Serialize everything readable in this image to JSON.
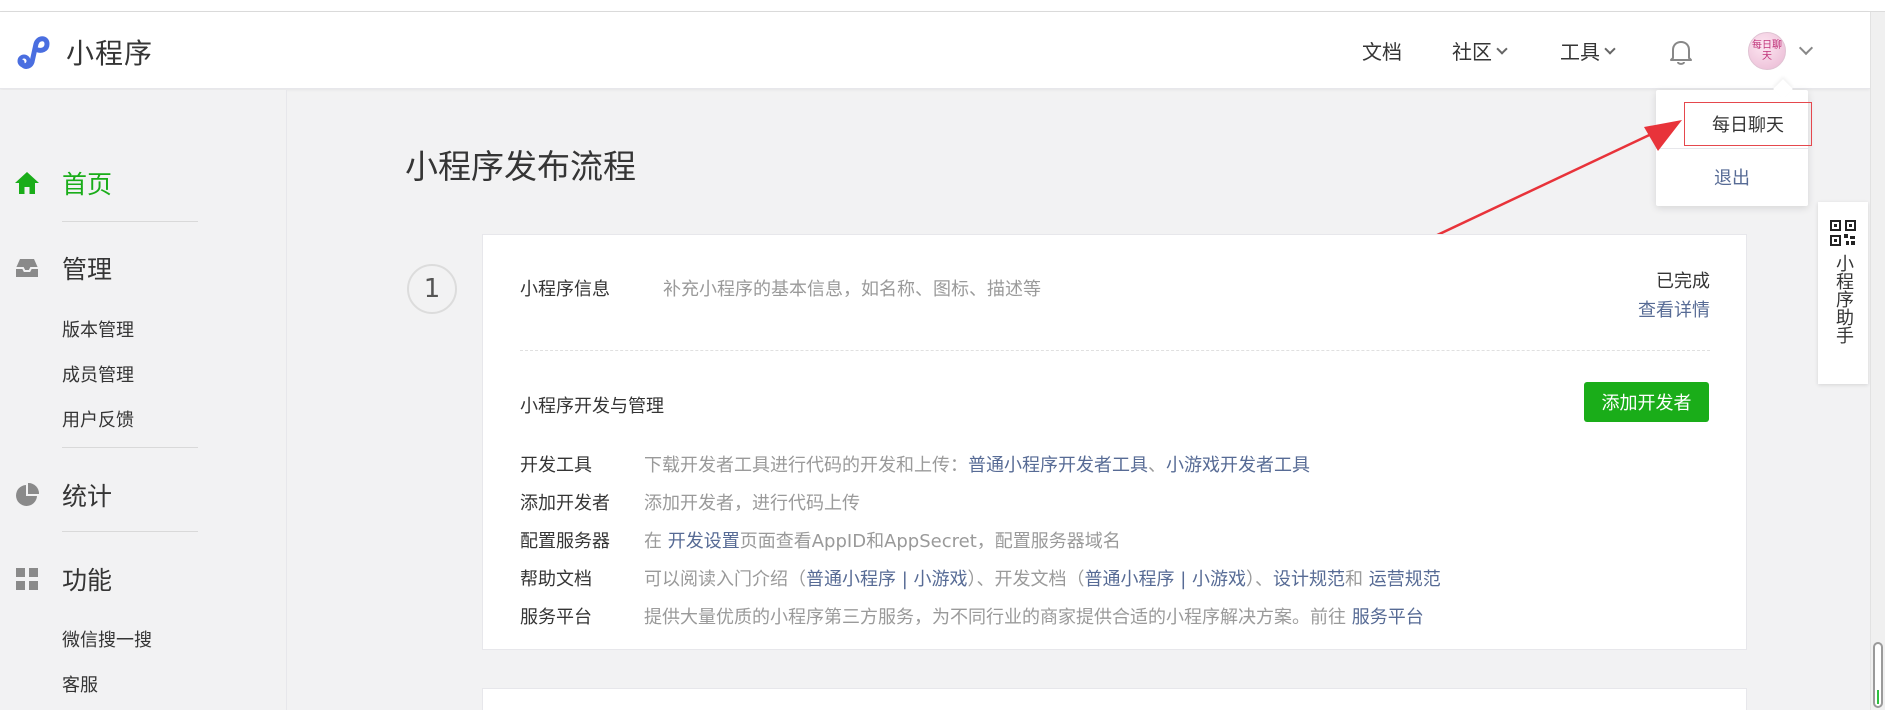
{
  "header": {
    "brand": "小程序",
    "nav": {
      "docs": "文档",
      "community": "社区",
      "tools": "工具"
    },
    "avatar_text": "每日聊天"
  },
  "dropdown": {
    "username": "每日聊天",
    "logout": "退出"
  },
  "helper": {
    "label": "小程序助手"
  },
  "sidebar": {
    "home": "首页",
    "manage": "管理",
    "manage_items": [
      "版本管理",
      "成员管理",
      "用户反馈"
    ],
    "stats": "统计",
    "features": "功能",
    "feature_items": [
      "微信搜一搜",
      "客服"
    ]
  },
  "main": {
    "title": "小程序发布流程",
    "step_number": "1",
    "info": {
      "title": "小程序信息",
      "desc": "补充小程序的基本信息，如名称、图标、描述等",
      "status": "已完成",
      "detail_link": "查看详情"
    },
    "dev": {
      "title": "小程序开发与管理",
      "add_button": "添加开发者",
      "rows": {
        "tools": {
          "key": "开发工具",
          "text": "下载开发者工具进行代码的开发和上传：",
          "link1": "普通小程序开发者工具",
          "sep": "、",
          "link2": "小游戏开发者工具"
        },
        "add_dev": {
          "key": "添加开发者",
          "text": "添加开发者，进行代码上传"
        },
        "server": {
          "key": "配置服务器",
          "pre": "在 ",
          "link": "开发设置",
          "post": "页面查看AppID和AppSecret，配置服务器域名"
        },
        "help": {
          "key": "帮助文档",
          "pre": "可以阅读入门介绍（",
          "l1": "普通小程序",
          "bar1": " | ",
          "l2": "小游戏",
          "mid": "）、开发文档（",
          "l3": "普通小程序",
          "bar2": " | ",
          "l4": "小游戏",
          "post": "）、",
          "l5": "设计规范",
          "and": "和 ",
          "l6": "运营规范"
        },
        "platform": {
          "key": "服务平台",
          "text": "提供大量优质的小程序第三方服务，为不同行业的商家提供合适的小程序解决方案。前往 ",
          "link": "服务平台"
        }
      }
    }
  }
}
